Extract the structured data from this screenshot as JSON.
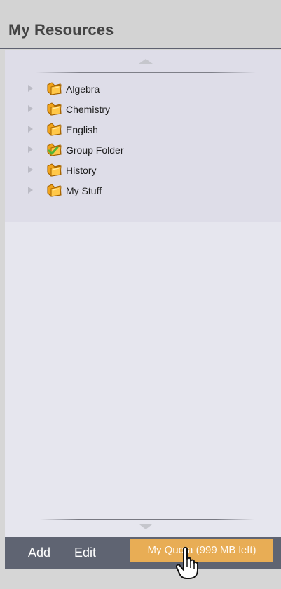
{
  "panel": {
    "title": "My Resources"
  },
  "tree": {
    "items": [
      {
        "label": "Algebra",
        "icon": "folder-icon"
      },
      {
        "label": "Chemistry",
        "icon": "folder-icon"
      },
      {
        "label": "English",
        "icon": "folder-icon"
      },
      {
        "label": "Group Folder",
        "icon": "shared-folder-icon"
      },
      {
        "label": "History",
        "icon": "folder-icon"
      },
      {
        "label": "My Stuff",
        "icon": "folder-icon"
      }
    ]
  },
  "footer": {
    "add_label": "Add",
    "edit_label": "Edit",
    "quota_label": "My Quota (999 MB left)"
  },
  "colors": {
    "header_bg": "#d3d3d3",
    "panel_bg": "#e6e6ee",
    "tree_bg": "#dedde8",
    "footer_bg": "#5f6472",
    "quota_bg": "#e8ad55",
    "folder_orange": "#f1a41a",
    "check_green": "#54b436"
  },
  "icons": {
    "scroll_up": "chevron-up-icon",
    "scroll_down": "chevron-down-icon",
    "expander": "chevron-right-icon",
    "cursor": "hand-pointer-icon"
  }
}
